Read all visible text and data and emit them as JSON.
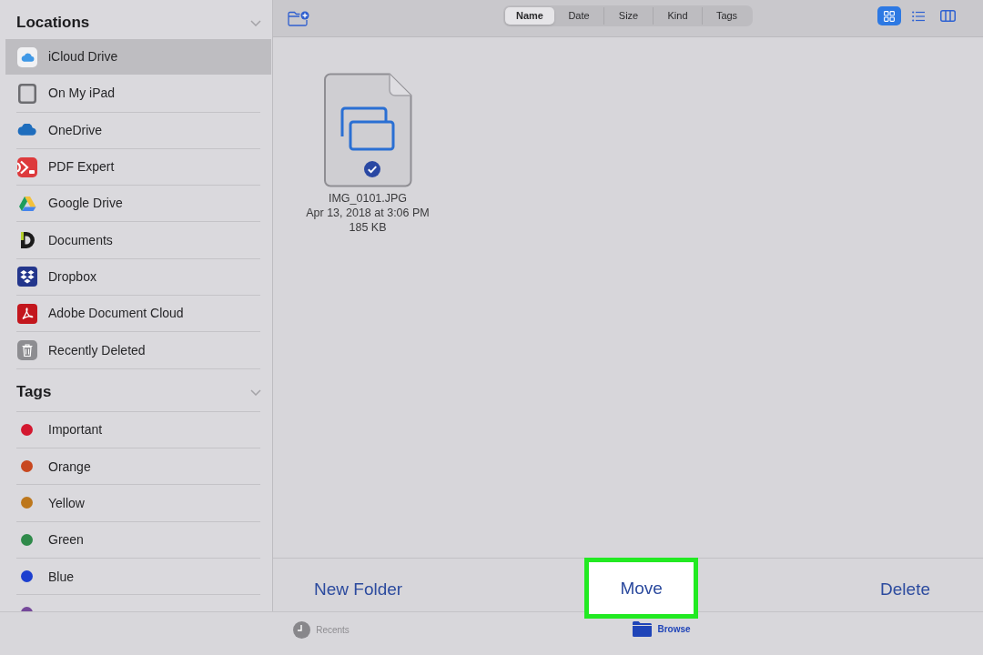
{
  "sidebar": {
    "locations": {
      "title": "Locations",
      "expanded": true,
      "items": [
        {
          "label": "iCloud Drive",
          "kind": "icloud",
          "selected": true
        },
        {
          "label": "On My iPad",
          "kind": "ipad",
          "selected": false
        },
        {
          "label": "OneDrive",
          "kind": "onedrive",
          "selected": false
        },
        {
          "label": "PDF Expert",
          "kind": "pdfexpert",
          "selected": false
        },
        {
          "label": "Google Drive",
          "kind": "googledrive",
          "selected": false
        },
        {
          "label": "Documents",
          "kind": "documents",
          "selected": false
        },
        {
          "label": "Dropbox",
          "kind": "dropbox",
          "selected": false
        },
        {
          "label": "Adobe Document Cloud",
          "kind": "adobe",
          "selected": false
        },
        {
          "label": "Recently Deleted",
          "kind": "trash",
          "selected": false
        }
      ]
    },
    "tags": {
      "title": "Tags",
      "expanded": true,
      "items": [
        {
          "label": "Important",
          "color": "#d3172f"
        },
        {
          "label": "Orange",
          "color": "#c8471f"
        },
        {
          "label": "Yellow",
          "color": "#bd771c"
        },
        {
          "label": "Green",
          "color": "#2f8a4a"
        },
        {
          "label": "Blue",
          "color": "#1c3fcf"
        },
        {
          "color": "#75489a"
        }
      ]
    }
  },
  "toolbar": {
    "sort_options": [
      {
        "label": "Name",
        "selected": true
      },
      {
        "label": "Date",
        "selected": false
      },
      {
        "label": "Size",
        "selected": false
      },
      {
        "label": "Kind",
        "selected": false
      },
      {
        "label": "Tags",
        "selected": false
      }
    ],
    "view_modes": [
      {
        "kind": "grid",
        "selected": true
      },
      {
        "kind": "list",
        "selected": false
      },
      {
        "kind": "columns",
        "selected": false
      }
    ]
  },
  "files": [
    {
      "name": "IMG_0101.JPG",
      "date": "Apr 13, 2018 at 3:06 PM",
      "size": "185 KB",
      "selected": true
    }
  ],
  "actions": [
    {
      "label": "New Folder",
      "highlighted": false
    },
    {
      "label": "Move",
      "highlighted": true
    },
    {
      "label": "Delete",
      "highlighted": false
    }
  ],
  "tab_bar": [
    {
      "label": "Recents",
      "kind": "recents",
      "selected": false
    },
    {
      "label": "Browse",
      "kind": "browse",
      "selected": true
    }
  ]
}
